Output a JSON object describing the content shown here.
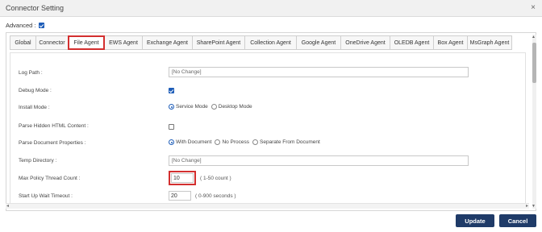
{
  "window": {
    "title": "Connector Setting",
    "close_symbol": "×"
  },
  "advanced": {
    "label": "Advanced :",
    "checked": true
  },
  "tabs": [
    {
      "label": "Global",
      "active": false
    },
    {
      "label": "Connector",
      "active": false
    },
    {
      "label": "File Agent",
      "active": true
    },
    {
      "label": "EWS Agent",
      "active": false
    },
    {
      "label": "Exchange Agent",
      "active": false
    },
    {
      "label": "SharePoint Agent",
      "active": false
    },
    {
      "label": "Collection Agent",
      "active": false
    },
    {
      "label": "Google Agent",
      "active": false
    },
    {
      "label": "OneDrive Agent",
      "active": false
    },
    {
      "label": "OLEDB Agent",
      "active": false
    },
    {
      "label": "Box Agent",
      "active": false
    },
    {
      "label": "MsGraph Agent",
      "active": false
    }
  ],
  "settings": {
    "log_path": {
      "label": "Log Path :",
      "value": "[No Change]"
    },
    "debug_mode": {
      "label": "Debug Mode :",
      "checked": true
    },
    "install_mode": {
      "label": "Install Mode :",
      "options": [
        "Service Mode",
        "Desktop Mode"
      ],
      "selected": "Service Mode"
    },
    "parse_hidden": {
      "label": "Parse Hidden HTML Content :",
      "checked": false
    },
    "parse_doc_props": {
      "label": "Parse Document Properties :",
      "options": [
        "With Document",
        "No Process",
        "Separate From Document"
      ],
      "selected": "With Document"
    },
    "temp_directory": {
      "label": "Temp Directory :",
      "value": "[No Change]"
    },
    "max_policy_threads": {
      "label": "Max Policy Thread Count :",
      "value": "10",
      "hint": "( 1-50 count )"
    },
    "startup_wait": {
      "label": "Start Up Wait Timeout :",
      "value": "20",
      "hint": "( 0-900 seconds )"
    }
  },
  "buttons": {
    "update": "Update",
    "cancel": "Cancel"
  },
  "colors": {
    "highlight": "#d32f2f",
    "primary_button": "#1f3b68",
    "checkbox": "#1e5db8"
  },
  "icons": {
    "close": "close-icon",
    "scroll_up": "arrow-up-icon",
    "scroll_down": "arrow-down-icon",
    "scroll_left": "arrow-left-icon",
    "scroll_right": "arrow-right-icon"
  }
}
